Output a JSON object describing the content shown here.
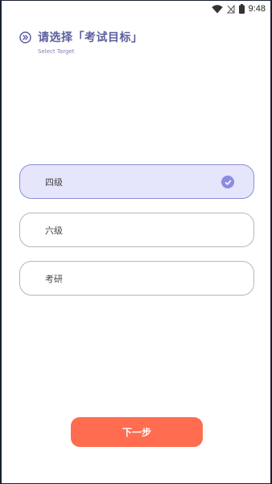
{
  "status_bar": {
    "time": "9:48",
    "icons": [
      "wifi-icon",
      "no-signal-icon",
      "battery-icon"
    ]
  },
  "header": {
    "icon": "double-chevron-right-icon",
    "title": "请选择「考试目标」",
    "subtitle": "Select Target"
  },
  "options": [
    {
      "label": "四级",
      "selected": true
    },
    {
      "label": "六级",
      "selected": false
    },
    {
      "label": "考研",
      "selected": false
    }
  ],
  "next_button": {
    "label": "下一步"
  },
  "colors": {
    "accent": "#5b5e9f",
    "selected_bg": "#e5e5fb",
    "check": "#8c8ce4",
    "button": "#ff6c4f"
  }
}
